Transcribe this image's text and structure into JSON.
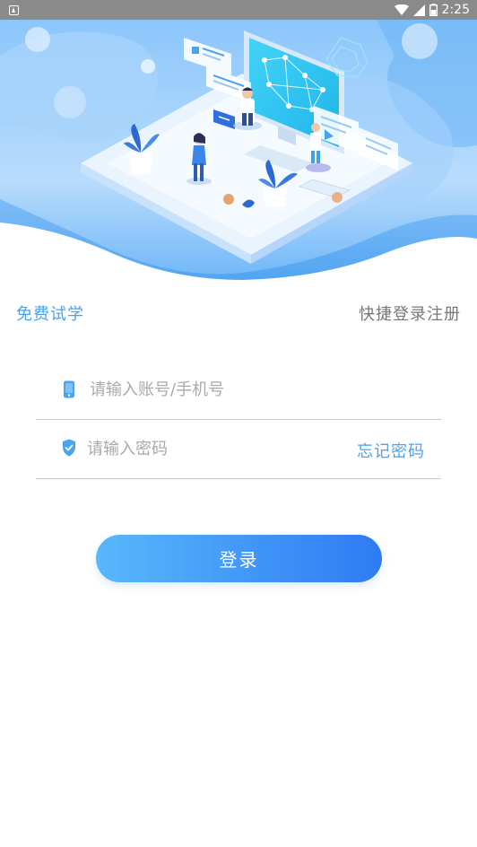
{
  "status_bar": {
    "time": "2:25",
    "icons": [
      "notification-a-icon",
      "wifi-icon",
      "signal-icon",
      "battery-icon"
    ]
  },
  "hero": {
    "illustration": "isometric medical technology illustration",
    "colors": {
      "primary": "#4aa3ef",
      "light": "#cfe6fc",
      "deep": "#2f7af4"
    }
  },
  "links": {
    "free_trial": "免费试学",
    "quick_register": "快捷登录注册"
  },
  "form": {
    "account_placeholder": "请输入账号/手机号",
    "password_placeholder": "请输入密码",
    "forgot_password": "忘记密码"
  },
  "login_button": "登录",
  "colors": {
    "accent": "#4aa3ef",
    "muted": "#777777",
    "placeholder": "#a9a9a9",
    "divider": "#a8d3f4",
    "button_start": "#58b8fb",
    "button_end": "#2f7af4"
  }
}
